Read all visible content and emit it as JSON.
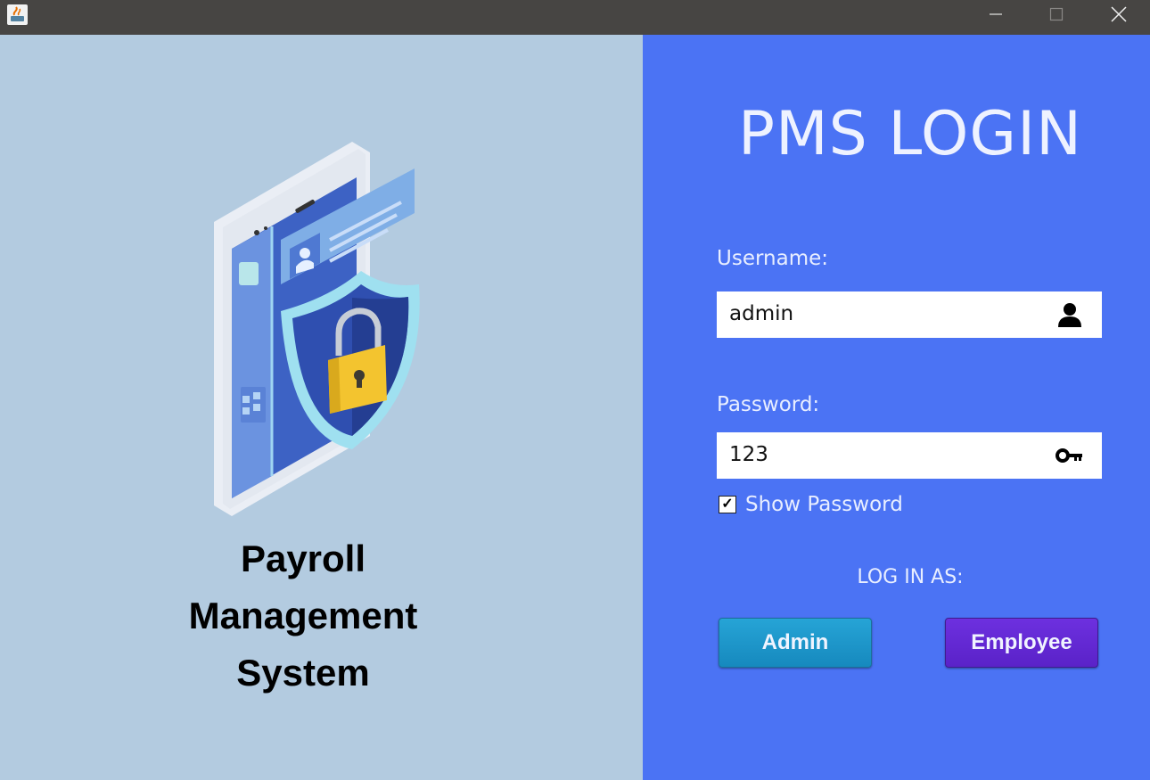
{
  "window": {
    "app_icon": "java-icon",
    "controls": [
      "minimize-icon",
      "maximize-icon",
      "close-icon"
    ]
  },
  "left_panel": {
    "illustration": "phone-lock-shield-illustration",
    "caption_lines": [
      "Payroll",
      "Management",
      "System"
    ]
  },
  "login": {
    "title": "PMS LOGIN",
    "username_label": "Username:",
    "username_value": "admin",
    "username_icon": "user-icon",
    "password_label": "Password:",
    "password_value": "123",
    "password_icon": "key-icon",
    "show_password_label": "Show Password",
    "show_password_checked": true,
    "check_mark": "✓",
    "login_as_label": "LOG IN AS:",
    "admin_button": "Admin",
    "employee_button": "Employee"
  },
  "colors": {
    "left_bg": "#b3cbe0",
    "right_bg": "#4b73f4",
    "admin_button": "#1e97cb",
    "employee_button": "#6429d4"
  }
}
